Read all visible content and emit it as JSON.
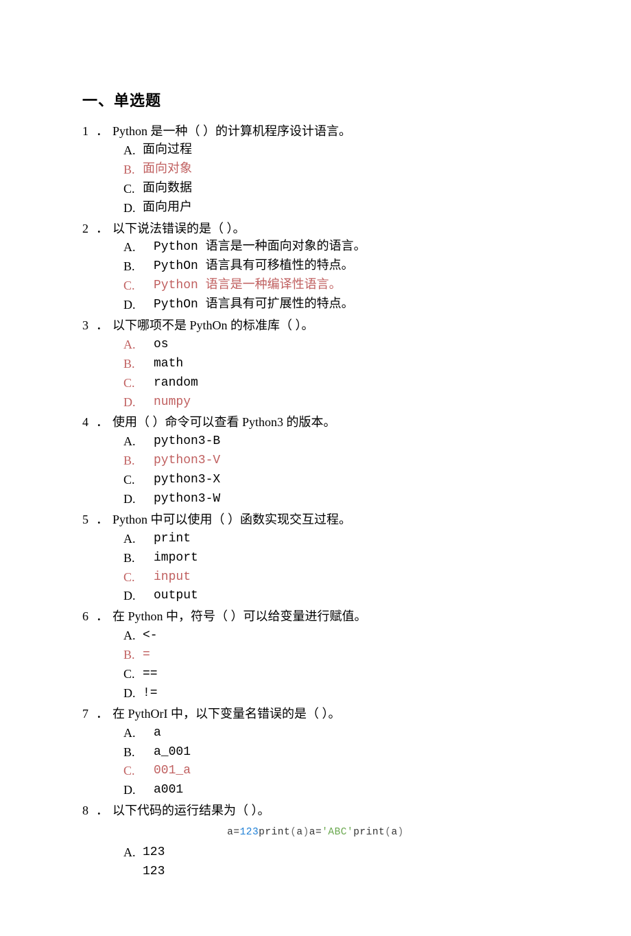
{
  "heading": "一、单选题",
  "questions": [
    {
      "num": "1",
      "stem": "Python 是一种（ ）的计算机程序设计语言。",
      "labelMode": "tight",
      "opts": [
        {
          "label": "A.",
          "text": "面向过程",
          "ans": false
        },
        {
          "label": "B.",
          "text": "面向对象",
          "ans": true
        },
        {
          "label": "C.",
          "text": "面向数据",
          "ans": false
        },
        {
          "label": "D.",
          "text": "面向用户",
          "ans": false
        }
      ]
    },
    {
      "num": "2",
      "stem": "以下说法错误的是（ ）。",
      "labelMode": "wide",
      "opts": [
        {
          "label": "A.",
          "text": "Python 语言是一种面向对象的语言。",
          "ans": false
        },
        {
          "label": "B.",
          "text": "PythOn 语言具有可移植性的特点。",
          "ans": false
        },
        {
          "label": "C.",
          "text": "Python 语言是一种编译性语言。",
          "ans": true
        },
        {
          "label": "D.",
          "text": "PythOn 语言具有可扩展性的特点。",
          "ans": false
        }
      ]
    },
    {
      "num": "3",
      "stem": "以下哪项不是 PythOn 的标准库（ ）。",
      "labelMode": "wide",
      "opts": [
        {
          "label": "A.",
          "text": "os",
          "ans": true,
          "labelAns": true,
          "textAns": false
        },
        {
          "label": "B.",
          "text": "math",
          "ans": true,
          "labelAns": true,
          "textAns": false
        },
        {
          "label": "C.",
          "text": "random",
          "ans": true,
          "labelAns": true,
          "textAns": false
        },
        {
          "label": "D.",
          "text": "numpy",
          "ans": true,
          "labelAns": true,
          "textAns": true
        }
      ]
    },
    {
      "num": "4",
      "stem": "使用（ ）命令可以查看 Python3 的版本。",
      "labelMode": "wide",
      "opts": [
        {
          "label": "A.",
          "text": "python3-B",
          "ans": false
        },
        {
          "label": "B.",
          "text": "python3-V",
          "ans": true
        },
        {
          "label": "C.",
          "text": "python3-X",
          "ans": false
        },
        {
          "label": "D.",
          "text": "python3-W",
          "ans": false
        }
      ]
    },
    {
      "num": "5",
      "stem": "Python 中可以使用（ ）函数实现交互过程。",
      "labelMode": "wide",
      "opts": [
        {
          "label": "A.",
          "text": "print",
          "ans": false
        },
        {
          "label": "B.",
          "text": "import",
          "ans": false
        },
        {
          "label": "C.",
          "text": "input",
          "ans": true
        },
        {
          "label": "D.",
          "text": "output",
          "ans": false
        }
      ]
    },
    {
      "num": "6",
      "stem": "在 Python 中，符号（ ）可以给变量进行赋值。",
      "labelMode": "tight",
      "opts": [
        {
          "label": "A.",
          "text": "<-",
          "ans": false
        },
        {
          "label": "B.",
          "text": "=",
          "ans": true
        },
        {
          "label": "C.",
          "text": "==",
          "ans": false
        },
        {
          "label": "D.",
          "text": "!=",
          "ans": false
        }
      ]
    },
    {
      "num": "7",
      "stem": "在 PythOrI 中，以下变量名错误的是（ ）。",
      "labelMode": "wide",
      "opts": [
        {
          "label": "A.",
          "text": "a",
          "ans": false
        },
        {
          "label": "B.",
          "text": "a_001",
          "ans": false
        },
        {
          "label": "C.",
          "text": "001_a",
          "ans": true
        },
        {
          "label": "D.",
          "text": "a001",
          "ans": false
        }
      ]
    },
    {
      "num": "8",
      "stem": "以下代码的运行结果为（ ）。",
      "labelMode": "tight",
      "codeParts": {
        "pre": "a=",
        "num": "123",
        "mid1": "print",
        "p1": "(",
        "a1": "a",
        "p2": ")",
        "mid2": "a=",
        "str": "'ABC'",
        "mid3": "print",
        "p3": "(",
        "a2": "a",
        "p4": ")"
      },
      "partialOpts": [
        {
          "label": "A.",
          "text": "123",
          "sub": "123"
        }
      ]
    }
  ]
}
